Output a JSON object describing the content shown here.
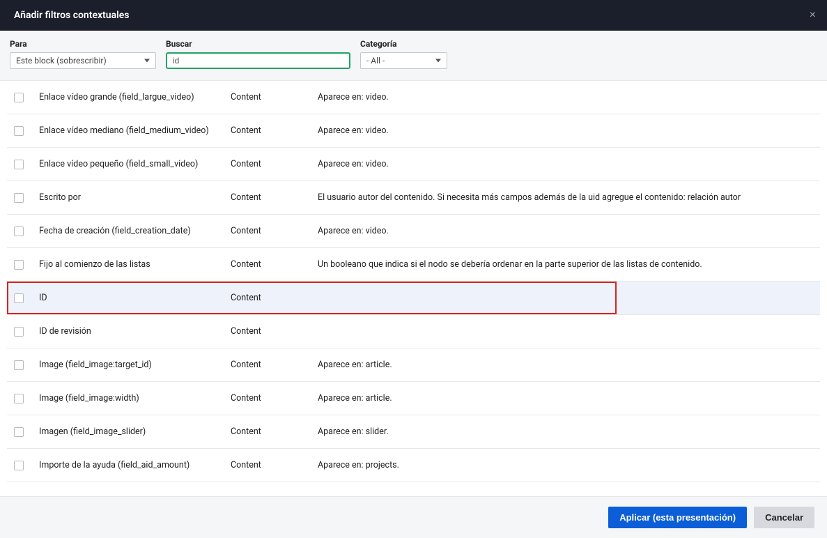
{
  "header": {
    "title": "Añadir filtros contextuales",
    "close": "×"
  },
  "filters": {
    "para": {
      "label": "Para",
      "value": "Este block (sobrescribir)"
    },
    "buscar": {
      "label": "Buscar",
      "value": "id"
    },
    "categoria": {
      "label": "Categoría",
      "value": "- All -"
    }
  },
  "rows": [
    {
      "name": "Enlace vídeo grande (field_largue_video)",
      "cat": "Content",
      "desc": "Aparece en: video."
    },
    {
      "name": "Enlace vídeo mediano (field_medium_video)",
      "cat": "Content",
      "desc": "Aparece en: video."
    },
    {
      "name": "Enlace vídeo pequeño (field_small_video)",
      "cat": "Content",
      "desc": "Aparece en: video."
    },
    {
      "name": "Escrito por",
      "cat": "Content",
      "desc": "El usuario autor del contenido. Si necesita más campos además de la uid agregue el contenido: relación autor"
    },
    {
      "name": "Fecha de creación (field_creation_date)",
      "cat": "Content",
      "desc": "Aparece en: video."
    },
    {
      "name": "Fijo al comienzo de las listas",
      "cat": "Content",
      "desc": "Un booleano que indica si el nodo se debería ordenar en la parte superior de las listas de contenido."
    },
    {
      "name": "ID",
      "cat": "Content",
      "desc": ""
    },
    {
      "name": "ID de revisión",
      "cat": "Content",
      "desc": ""
    },
    {
      "name": "Image (field_image:target_id)",
      "cat": "Content",
      "desc": "Aparece en: article."
    },
    {
      "name": "Image (field_image:width)",
      "cat": "Content",
      "desc": "Aparece en: article."
    },
    {
      "name": "Imagen (field_image_slider)",
      "cat": "Content",
      "desc": "Aparece en: slider."
    },
    {
      "name": "Importe de la ayuda (field_aid_amount)",
      "cat": "Content",
      "desc": "Aparece en: projects."
    }
  ],
  "footer": {
    "apply": "Aplicar (esta presentación)",
    "cancel": "Cancelar"
  }
}
